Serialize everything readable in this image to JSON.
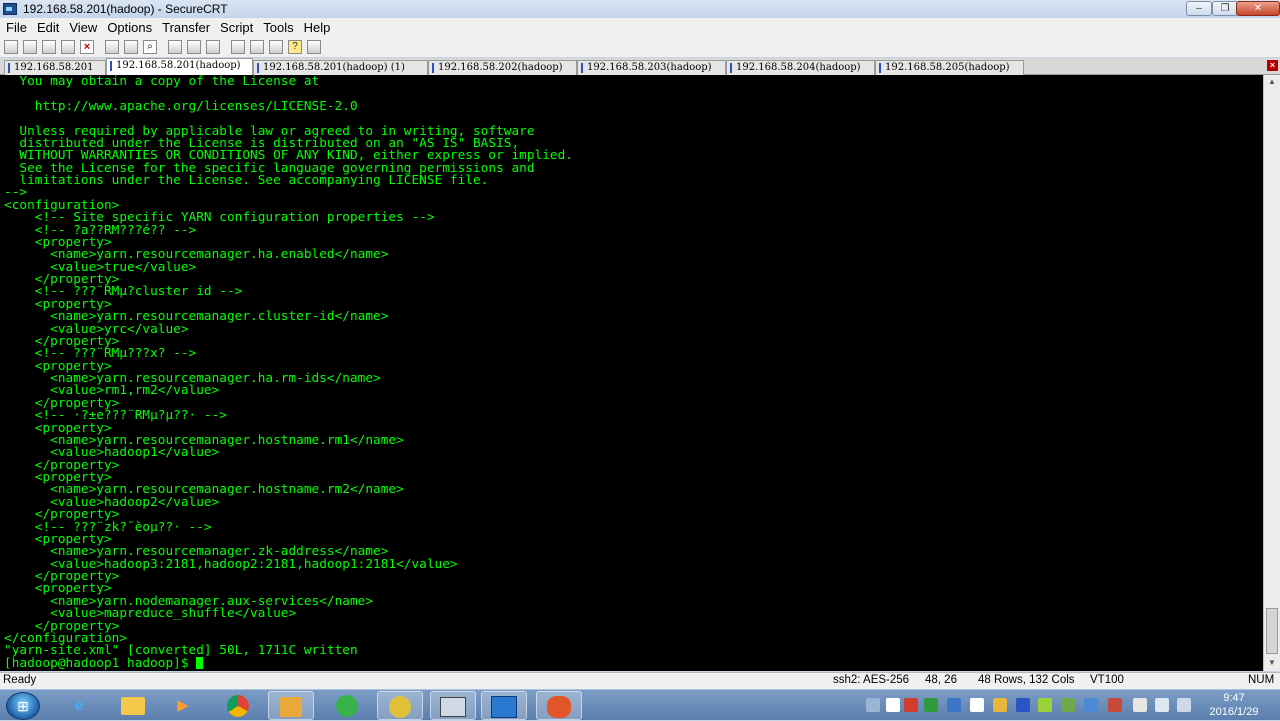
{
  "window": {
    "title": "192.168.58.201(hadoop) - SecureCRT",
    "minimize_label": "–",
    "maximize_label": "❐",
    "close_label": "✕"
  },
  "menu": [
    "File",
    "Edit",
    "View",
    "Options",
    "Transfer",
    "Script",
    "Tools",
    "Help"
  ],
  "tabs": [
    {
      "label": "192.168.58.201",
      "active": false
    },
    {
      "label": "192.168.58.201(hadoop)",
      "active": true
    },
    {
      "label": "192.168.58.201(hadoop) (1)",
      "active": false
    },
    {
      "label": "192.168.58.202(hadoop)",
      "active": false
    },
    {
      "label": "192.168.58.203(hadoop)",
      "active": false
    },
    {
      "label": "192.168.58.204(hadoop)",
      "active": false
    },
    {
      "label": "192.168.58.205(hadoop)",
      "active": false
    }
  ],
  "terminal": {
    "lines": [
      "  You may obtain a copy of the License at",
      "",
      "    http://www.apache.org/licenses/LICENSE-2.0",
      "",
      "  Unless required by applicable law or agreed to in writing, software",
      "  distributed under the License is distributed on an \"AS IS\" BASIS,",
      "  WITHOUT WARRANTIES OR CONDITIONS OF ANY KIND, either express or implied.",
      "  See the License for the specific language governing permissions and",
      "  limitations under the License. See accompanying LICENSE file.",
      "-->",
      "<configuration>",
      "    <!-- Site specific YARN configuration properties -->",
      "    <!-- ?a??RM???é?? -->",
      "    <property>",
      "      <name>yarn.resourcemanager.ha.enabled</name>",
      "      <value>true</value>",
      "    </property>",
      "    <!-- ???¨RMµ?cluster id -->",
      "    <property>",
      "      <name>yarn.resourcemanager.cluster-id</name>",
      "      <value>yrc</value>",
      "    </property>",
      "    <!-- ???¨RMµ???x? -->",
      "    <property>",
      "      <name>yarn.resourcemanager.ha.rm-ids</name>",
      "      <value>rm1,rm2</value>",
      "    </property>",
      "    <!-- ·?±e???¨RMµ?µ??· -->",
      "    <property>",
      "      <name>yarn.resourcemanager.hostname.rm1</name>",
      "      <value>hadoop1</value>",
      "    </property>",
      "    <property>",
      "      <name>yarn.resourcemanager.hostname.rm2</name>",
      "      <value>hadoop2</value>",
      "    </property>",
      "    <!-- ???¨zk?¯èoµ??· -->",
      "    <property>",
      "      <name>yarn.resourcemanager.zk-address</name>",
      "      <value>hadoop3:2181,hadoop2:2181,hadoop1:2181</value>",
      "    </property>",
      "    <property>",
      "      <name>yarn.nodemanager.aux-services</name>",
      "      <value>mapreduce_shuffle</value>",
      "    </property>",
      "</configuration>",
      "\"yarn-site.xml\" [converted] 50L, 1711C written",
      "[hadoop@hadoop1 hadoop]$ "
    ]
  },
  "status": {
    "left": "Ready",
    "encryption": "ssh2: AES-256",
    "cursor": "48,  26",
    "size": "48 Rows, 132 Cols",
    "emulation": "VT100",
    "numlock": "NUM"
  },
  "taskbar": {
    "time": "9:47",
    "date": "2016/1/29"
  }
}
